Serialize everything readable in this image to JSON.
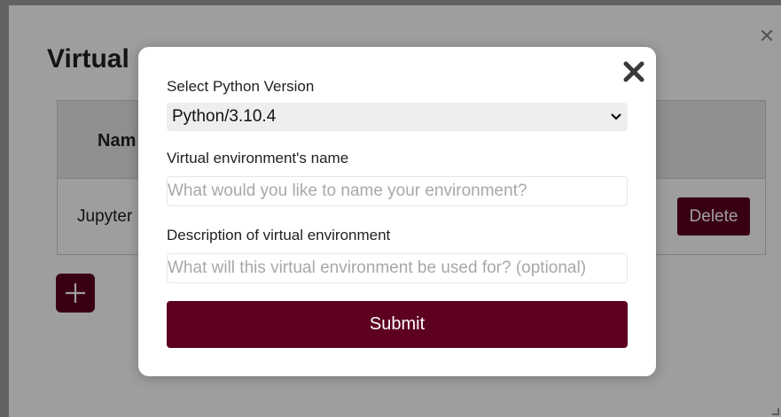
{
  "background": {
    "title": "Virtual",
    "table": {
      "header_name": "Nam",
      "row_name": "Jupyter",
      "delete_label": "Delete"
    },
    "close_icon": "close-icon",
    "add_icon": "plus-icon"
  },
  "modal": {
    "close_icon": "bold-close-icon",
    "python_version": {
      "label": "Select Python Version",
      "selected": "Python/3.10.4"
    },
    "env_name": {
      "label": "Virtual environment's name",
      "value": "",
      "placeholder": "What would you like to name your environment?"
    },
    "description": {
      "label": "Description of virtual environment",
      "value": "",
      "placeholder": "What will this virtual environment be used for? (optional)"
    },
    "submit_label": "Submit"
  },
  "colors": {
    "accent": "#5d0022",
    "overlay": "rgba(0,0,0,0.38)"
  }
}
